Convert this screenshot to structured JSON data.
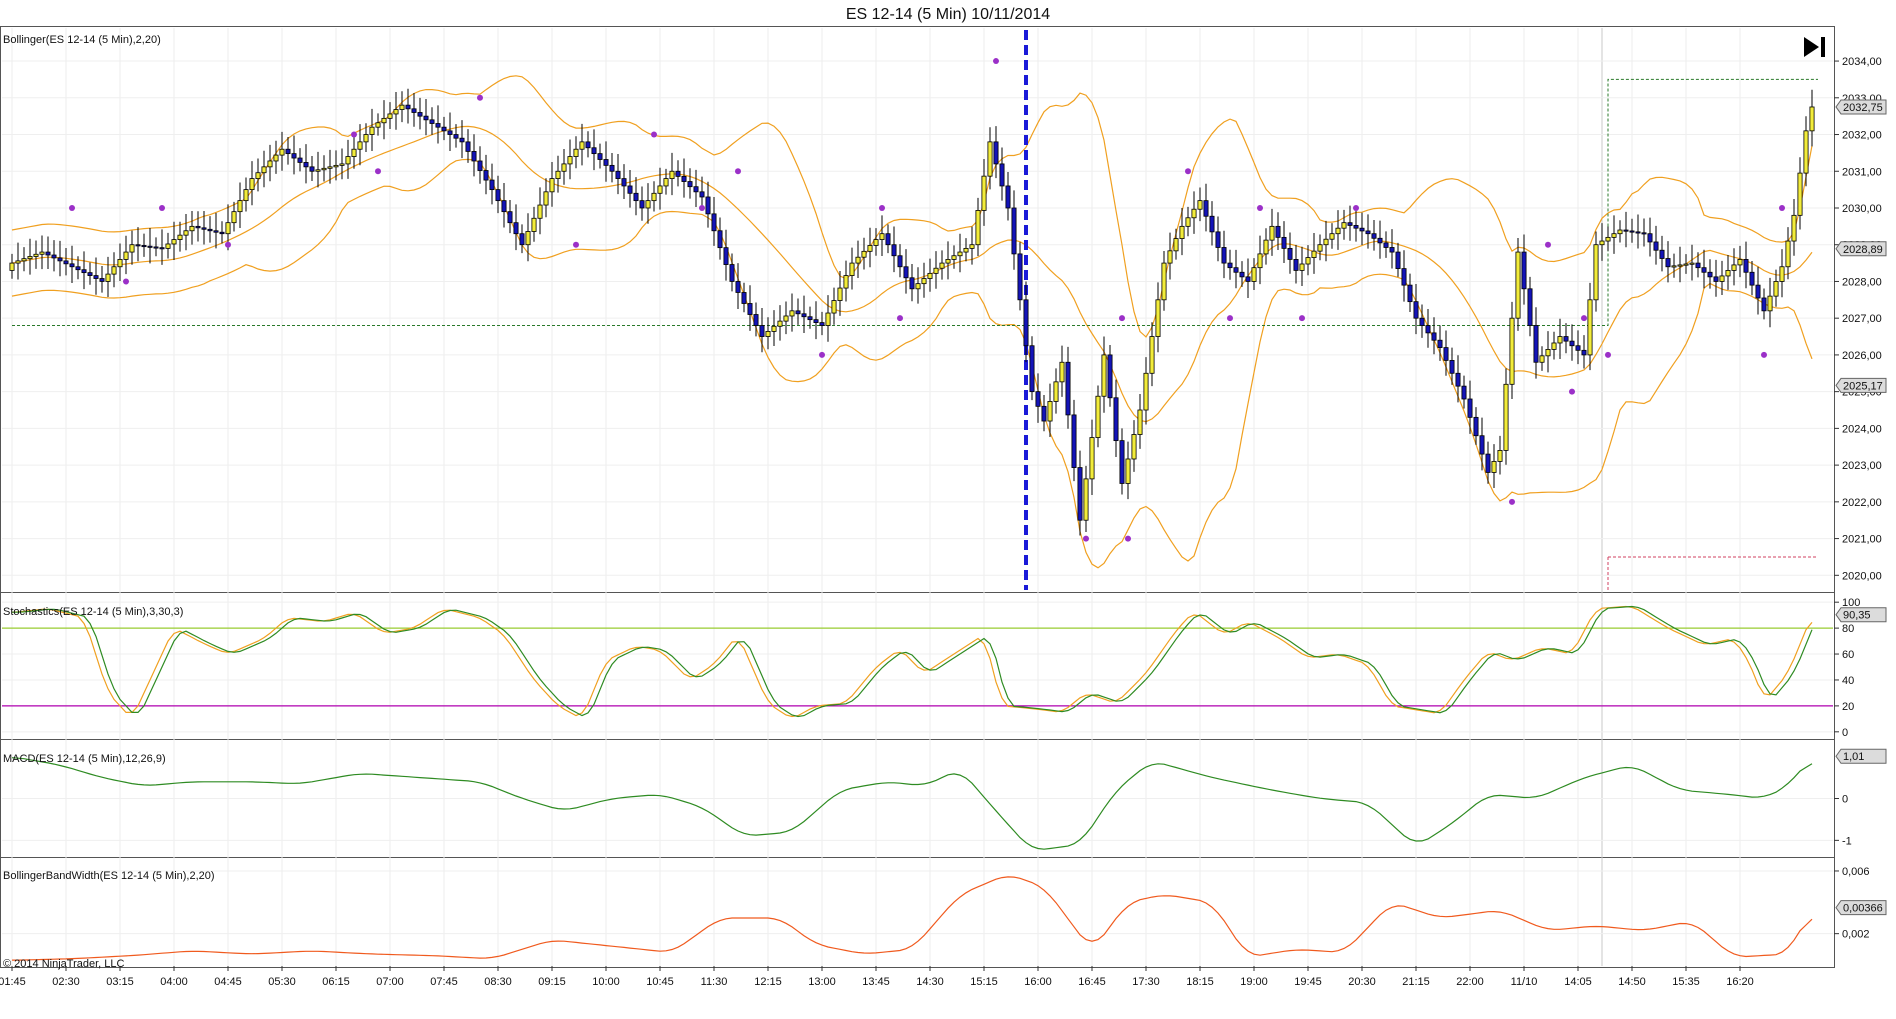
{
  "window": {
    "title": "ES 12-14 (5 Min)  10/11/2014"
  },
  "colors": {
    "bull_candle": "#f2ec3a",
    "bear_candle": "#1414b8",
    "band": "#f0a020",
    "stoch_k": "#2e8b22",
    "stoch_d": "#f0a020",
    "stoch_upper": "#9acd32",
    "stoch_lower": "#b000b0",
    "macd": "#2e8b22",
    "bbw": "#f05a1e",
    "swing_dot": "#9b30c8",
    "session_line": "#1a1ad8",
    "pivot_green": "#2a7a2a",
    "pivot_red": "#d04060"
  },
  "icons": {
    "jump_to_end": "skip-to-end-icon"
  },
  "copyright": "© 2014 NinjaTrader, LLC",
  "chart_data": [
    {
      "type": "candlestick",
      "label": "Bollinger(ES 12-14 (5 Min),2,20)",
      "ylim": [
        2019.6,
        2034.9
      ],
      "y_ticks": [
        "2034,00",
        "2033,00",
        "2032,00",
        "2031,00",
        "2030,00",
        "2029,00",
        "2028,00",
        "2027,00",
        "2026,00",
        "2025,00",
        "2024,00",
        "2023,00",
        "2022,00",
        "2021,00",
        "2020,00"
      ],
      "price_badges": [
        "2032,75",
        "2028,89",
        "2025,17"
      ],
      "close_anchors": [
        [
          0,
          2028.5
        ],
        [
          5,
          2028.8
        ],
        [
          10,
          2028.4
        ],
        [
          15,
          2028.0
        ],
        [
          20,
          2029.0
        ],
        [
          25,
          2028.9
        ],
        [
          30,
          2029.5
        ],
        [
          35,
          2029.3
        ],
        [
          40,
          2030.8
        ],
        [
          45,
          2031.6
        ],
        [
          50,
          2031.0
        ],
        [
          55,
          2031.2
        ],
        [
          60,
          2032.2
        ],
        [
          65,
          2032.8
        ],
        [
          70,
          2032.3
        ],
        [
          75,
          2031.8
        ],
        [
          80,
          2030.5
        ],
        [
          85,
          2029.0
        ],
        [
          90,
          2030.8
        ],
        [
          95,
          2031.8
        ],
        [
          100,
          2031.0
        ],
        [
          105,
          2030.0
        ],
        [
          110,
          2031.0
        ],
        [
          115,
          2030.3
        ],
        [
          120,
          2028.0
        ],
        [
          125,
          2026.5
        ],
        [
          130,
          2027.2
        ],
        [
          135,
          2026.8
        ],
        [
          140,
          2028.5
        ],
        [
          145,
          2029.3
        ],
        [
          150,
          2027.8
        ],
        [
          155,
          2028.5
        ],
        [
          160,
          2029.0
        ],
        [
          163,
          2031.8
        ],
        [
          166,
          2030.0
        ],
        [
          170,
          2025.0
        ],
        [
          172,
          2024.2
        ],
        [
          175,
          2025.8
        ],
        [
          178,
          2021.5
        ],
        [
          182,
          2026.0
        ],
        [
          185,
          2022.5
        ],
        [
          188,
          2024.5
        ],
        [
          192,
          2028.5
        ],
        [
          195,
          2029.5
        ],
        [
          198,
          2030.2
        ],
        [
          202,
          2028.5
        ],
        [
          206,
          2028.0
        ],
        [
          210,
          2029.5
        ],
        [
          214,
          2028.3
        ],
        [
          218,
          2029.0
        ],
        [
          222,
          2029.6
        ],
        [
          226,
          2029.3
        ],
        [
          230,
          2028.8
        ],
        [
          234,
          2027.0
        ],
        [
          238,
          2026.2
        ],
        [
          242,
          2024.8
        ],
        [
          246,
          2022.8
        ],
        [
          248,
          2023.4
        ],
        [
          251,
          2028.8
        ],
        [
          254,
          2025.8
        ],
        [
          258,
          2026.5
        ],
        [
          262,
          2026.0
        ],
        [
          264,
          2029.0
        ],
        [
          268,
          2029.4
        ],
        [
          272,
          2029.3
        ],
        [
          276,
          2028.4
        ],
        [
          280,
          2028.5
        ],
        [
          284,
          2028.0
        ],
        [
          288,
          2028.6
        ],
        [
          292,
          2027.2
        ],
        [
          295,
          2028.4
        ],
        [
          297,
          2029.8
        ],
        [
          299,
          2032.1
        ],
        [
          300,
          2032.75
        ]
      ],
      "swing_highs": [
        [
          10,
          2030
        ],
        [
          25,
          2030
        ],
        [
          57,
          2032
        ],
        [
          78,
          2033
        ],
        [
          107,
          2032
        ],
        [
          121,
          2031
        ],
        [
          145,
          2030
        ],
        [
          164,
          2034
        ],
        [
          185,
          2027
        ],
        [
          196,
          2031
        ],
        [
          208,
          2030
        ],
        [
          224,
          2030
        ],
        [
          256,
          2029
        ],
        [
          262,
          2027
        ],
        [
          295,
          2030
        ]
      ],
      "swing_lows": [
        [
          19,
          2028
        ],
        [
          36,
          2029
        ],
        [
          61,
          2031
        ],
        [
          94,
          2029
        ],
        [
          115,
          2030
        ],
        [
          135,
          2026
        ],
        [
          148,
          2027
        ],
        [
          179,
          2021
        ],
        [
          186,
          2021
        ],
        [
          203,
          2027
        ],
        [
          215,
          2027
        ],
        [
          250,
          2022
        ],
        [
          260,
          2025
        ],
        [
          266,
          2026
        ],
        [
          292,
          2026
        ]
      ],
      "session_break_index": 169,
      "day_break_index": 265,
      "pivot_prev_y": 2026.8,
      "pivot_new_high": 2033.5,
      "pivot_new_low": 2020.5
    },
    {
      "type": "line",
      "label": "Stochastics(ES 12-14 (5 Min),3,30,3)",
      "ylim": [
        -4,
        104
      ],
      "y_ticks": [
        "100",
        "80",
        "60",
        "40",
        "20",
        "0"
      ],
      "levels": [
        80,
        20
      ],
      "value_badge": "90,35",
      "anchors": [
        [
          0,
          92
        ],
        [
          6,
          95
        ],
        [
          12,
          88
        ],
        [
          16,
          30
        ],
        [
          20,
          10
        ],
        [
          24,
          50
        ],
        [
          27,
          80
        ],
        [
          32,
          68
        ],
        [
          36,
          60
        ],
        [
          42,
          72
        ],
        [
          46,
          88
        ],
        [
          52,
          85
        ],
        [
          57,
          92
        ],
        [
          62,
          76
        ],
        [
          67,
          80
        ],
        [
          72,
          95
        ],
        [
          78,
          88
        ],
        [
          82,
          75
        ],
        [
          87,
          40
        ],
        [
          91,
          20
        ],
        [
          95,
          10
        ],
        [
          99,
          55
        ],
        [
          104,
          66
        ],
        [
          108,
          63
        ],
        [
          113,
          40
        ],
        [
          117,
          52
        ],
        [
          121,
          75
        ],
        [
          126,
          22
        ],
        [
          130,
          10
        ],
        [
          134,
          20
        ],
        [
          139,
          22
        ],
        [
          144,
          50
        ],
        [
          148,
          64
        ],
        [
          152,
          45
        ],
        [
          157,
          60
        ],
        [
          162,
          75
        ],
        [
          165,
          20
        ],
        [
          170,
          18
        ],
        [
          175,
          15
        ],
        [
          179,
          30
        ],
        [
          184,
          22
        ],
        [
          189,
          45
        ],
        [
          194,
          78
        ],
        [
          197,
          93
        ],
        [
          202,
          75
        ],
        [
          206,
          85
        ],
        [
          211,
          73
        ],
        [
          216,
          57
        ],
        [
          221,
          60
        ],
        [
          226,
          52
        ],
        [
          230,
          20
        ],
        [
          234,
          17
        ],
        [
          238,
          14
        ],
        [
          242,
          40
        ],
        [
          246,
          62
        ],
        [
          250,
          55
        ],
        [
          255,
          65
        ],
        [
          260,
          60
        ],
        [
          264,
          95
        ],
        [
          270,
          97
        ],
        [
          276,
          80
        ],
        [
          282,
          67
        ],
        [
          287,
          72
        ],
        [
          290,
          50
        ],
        [
          292,
          23
        ],
        [
          296,
          45
        ],
        [
          300,
          90
        ]
      ],
      "d_lag": 1.4
    },
    {
      "type": "line",
      "label": "MACD(ES 12-14 (5 Min),12,26,9)",
      "ylim": [
        -1.35,
        1.35
      ],
      "y_ticks": [
        "0",
        "-1"
      ],
      "value_badge": "1,01",
      "anchors": [
        [
          0,
          1.0
        ],
        [
          8,
          0.8
        ],
        [
          15,
          0.5
        ],
        [
          22,
          0.3
        ],
        [
          30,
          0.4
        ],
        [
          40,
          0.4
        ],
        [
          48,
          0.35
        ],
        [
          58,
          0.6
        ],
        [
          68,
          0.5
        ],
        [
          78,
          0.4
        ],
        [
          85,
          0.0
        ],
        [
          92,
          -0.3
        ],
        [
          100,
          0.0
        ],
        [
          108,
          0.1
        ],
        [
          115,
          -0.2
        ],
        [
          122,
          -0.9
        ],
        [
          130,
          -0.8
        ],
        [
          138,
          0.2
        ],
        [
          146,
          0.4
        ],
        [
          152,
          0.3
        ],
        [
          158,
          0.7
        ],
        [
          164,
          -0.3
        ],
        [
          170,
          -1.25
        ],
        [
          178,
          -1.1
        ],
        [
          184,
          0.2
        ],
        [
          190,
          0.9
        ],
        [
          200,
          0.5
        ],
        [
          210,
          0.2
        ],
        [
          218,
          0.0
        ],
        [
          226,
          -0.1
        ],
        [
          234,
          -1.15
        ],
        [
          240,
          -0.6
        ],
        [
          246,
          0.1
        ],
        [
          254,
          0.0
        ],
        [
          262,
          0.5
        ],
        [
          270,
          0.8
        ],
        [
          278,
          0.2
        ],
        [
          286,
          0.1
        ],
        [
          292,
          0.0
        ],
        [
          296,
          0.3
        ],
        [
          300,
          1.01
        ]
      ]
    },
    {
      "type": "line",
      "label": "BollingerBandWidth(ES 12-14 (5 Min),2,20)",
      "ylim": [
        0.0,
        0.0067
      ],
      "y_ticks": [
        "0,006",
        "0,002"
      ],
      "value_badge": "0,00366",
      "anchors": [
        [
          0,
          0.0003
        ],
        [
          10,
          0.0004
        ],
        [
          20,
          0.0006
        ],
        [
          30,
          0.0009
        ],
        [
          40,
          0.0007
        ],
        [
          50,
          0.0009
        ],
        [
          60,
          0.0007
        ],
        [
          70,
          0.0006
        ],
        [
          80,
          0.0004
        ],
        [
          90,
          0.0016
        ],
        [
          100,
          0.0012
        ],
        [
          110,
          0.0008
        ],
        [
          118,
          0.003
        ],
        [
          128,
          0.003
        ],
        [
          134,
          0.0013
        ],
        [
          142,
          0.0007
        ],
        [
          150,
          0.001
        ],
        [
          158,
          0.0045
        ],
        [
          166,
          0.0058
        ],
        [
          172,
          0.005
        ],
        [
          180,
          0.0009
        ],
        [
          186,
          0.004
        ],
        [
          192,
          0.0045
        ],
        [
          200,
          0.004
        ],
        [
          206,
          0.0005
        ],
        [
          214,
          0.001
        ],
        [
          222,
          0.0008
        ],
        [
          230,
          0.004
        ],
        [
          238,
          0.003
        ],
        [
          248,
          0.0035
        ],
        [
          256,
          0.0022
        ],
        [
          264,
          0.0025
        ],
        [
          272,
          0.0022
        ],
        [
          280,
          0.0028
        ],
        [
          287,
          0.0005
        ],
        [
          296,
          0.0007
        ],
        [
          300,
          0.00366
        ]
      ]
    }
  ],
  "time_axis": {
    "labels": [
      "01:45",
      "02:30",
      "03:15",
      "04:00",
      "04:45",
      "05:30",
      "06:15",
      "07:00",
      "07:45",
      "08:30",
      "09:15",
      "10:00",
      "10:45",
      "11:30",
      "12:15",
      "13:00",
      "13:45",
      "14:30",
      "15:15",
      "16:00",
      "16:45",
      "17:30",
      "18:15",
      "19:00",
      "19:45",
      "20:30",
      "21:15",
      "22:00",
      "11/10",
      "14:05",
      "14:50",
      "15:35",
      "16:20"
    ],
    "bar_index": [
      0,
      9,
      18,
      27,
      36,
      45,
      54,
      63,
      72,
      81,
      90,
      99,
      108,
      117,
      126,
      135,
      144,
      153,
      162,
      171,
      180,
      189,
      198,
      207,
      216,
      225,
      234,
      243,
      252,
      261,
      270,
      279,
      288
    ]
  }
}
